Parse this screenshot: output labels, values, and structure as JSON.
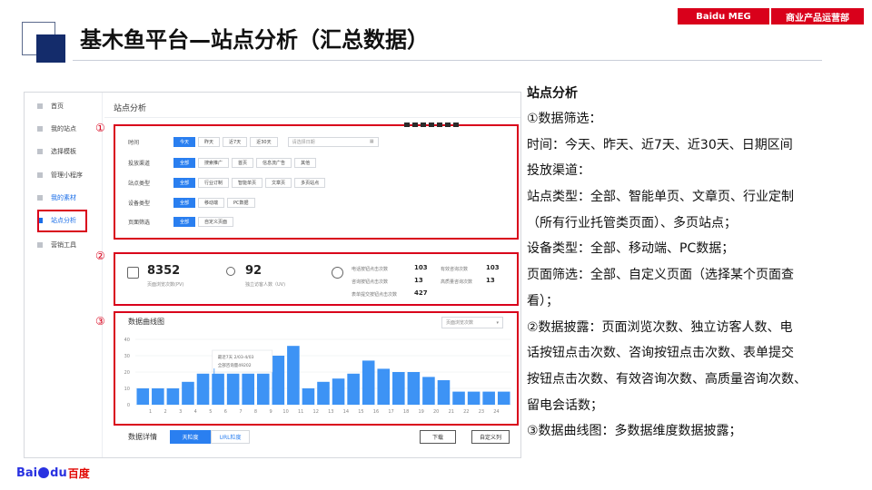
{
  "header": {
    "title": "基木鱼平台—站点分析（汇总数据）",
    "badge_meg": "Baidu MEG",
    "badge_dept": "商业产品运营部"
  },
  "colors": {
    "accent_red": "#d9001b",
    "brand_blue": "#2a7ff0",
    "navy": "#142c6b"
  },
  "sidebar": {
    "items": [
      {
        "label": "首页"
      },
      {
        "label": "我的站点"
      },
      {
        "label": "选择模板"
      },
      {
        "label": "管理小程序"
      },
      {
        "label": "我的素材"
      },
      {
        "label": "站点分析"
      },
      {
        "label": "营销工具"
      }
    ]
  },
  "main": {
    "title": "站点分析"
  },
  "markers": [
    "①",
    "②",
    "③"
  ],
  "filters": {
    "time": {
      "label": "时间",
      "options": [
        "今天",
        "昨天",
        "近7天",
        "近30天"
      ],
      "date_placeholder": "请选择日期"
    },
    "channel": {
      "label": "投放渠道",
      "options": [
        "全部",
        "搜索推广",
        "首页",
        "信息流广告",
        "其他"
      ]
    },
    "site_type": {
      "label": "站点类型",
      "options": [
        "全部",
        "行业订制",
        "智能单页",
        "文章页",
        "多页站点"
      ]
    },
    "device": {
      "label": "设备类型",
      "options": [
        "全部",
        "移动端",
        "PC数据"
      ]
    },
    "page": {
      "label": "页面筛选",
      "options": [
        "全部",
        "自定义页面"
      ]
    }
  },
  "stats": {
    "pv_value": "8352",
    "pv_label": "页面浏览次数(PV)",
    "uv_value": "92",
    "uv_label": "独立访客人数（UV)",
    "right": [
      {
        "label": "电话按钮点击次数",
        "value": "103"
      },
      {
        "label": "咨询按钮点击次数",
        "value": "13"
      },
      {
        "label": "表单提交按钮点击次数",
        "value": "427"
      },
      {
        "label": "有效咨询次数",
        "value": "103"
      },
      {
        "label": "高质量咨询次数",
        "value": "13"
      }
    ]
  },
  "chart": {
    "title": "数据曲线图",
    "select_value": "页面浏览次数",
    "tooltip_line1": "最近7天 2/03-4/03",
    "tooltip_line2": "全部咨询量49202"
  },
  "chart_data": {
    "type": "bar",
    "categories": [
      "0",
      "1",
      "2",
      "3",
      "4",
      "5",
      "6",
      "7",
      "8",
      "9",
      "10",
      "11",
      "12",
      "13",
      "14",
      "15",
      "16",
      "17",
      "18",
      "19",
      "20",
      "21",
      "22",
      "23",
      "24"
    ],
    "values": [
      10,
      10,
      10,
      14,
      19,
      19,
      19,
      19,
      19,
      30,
      36,
      10,
      14,
      16,
      19,
      27,
      22,
      20,
      20,
      17,
      15,
      8,
      8,
      8,
      8
    ],
    "ylim": [
      0,
      40
    ],
    "yticks": [
      "0",
      "10",
      "20",
      "30",
      "40"
    ],
    "xticks": [
      "1",
      "2",
      "3",
      "4",
      "5",
      "6",
      "7",
      "8",
      "9",
      "10",
      "11",
      "12",
      "13",
      "14",
      "15",
      "16",
      "17",
      "18",
      "19",
      "20",
      "21",
      "22",
      "23",
      "24"
    ],
    "grid": true,
    "xlabel": "",
    "ylabel": ""
  },
  "detail": {
    "title": "数据详情",
    "tab_web": "天粒度",
    "tab_url": "URL粒度",
    "download": "下载",
    "custom_cols": "自定义列"
  },
  "description": {
    "title": "站点分析",
    "lines": [
      "①数据筛选：",
      "时间：今天、昨天、近7天、近30天、日期区间",
      "投放渠道：",
      "站点类型：全部、智能单页、文章页、行业定制",
      "（所有行业托管类页面）、多页站点；",
      "设备类型：全部、移动端、PC数据；",
      "页面筛选：全部、自定义页面（选择某个页面查",
      "看）；",
      "②数据披露：页面浏览次数、独立访客人数、电",
      "话按钮点击次数、咨询按钮点击次数、表单提交",
      "按钮点击次数、有效咨询次数、高质量咨询次数、",
      "留电会话数；",
      "③数据曲线图：多数据维度数据披露；"
    ]
  },
  "logo": {
    "bai": "Bai",
    "du": "du",
    "cn": "百度"
  }
}
